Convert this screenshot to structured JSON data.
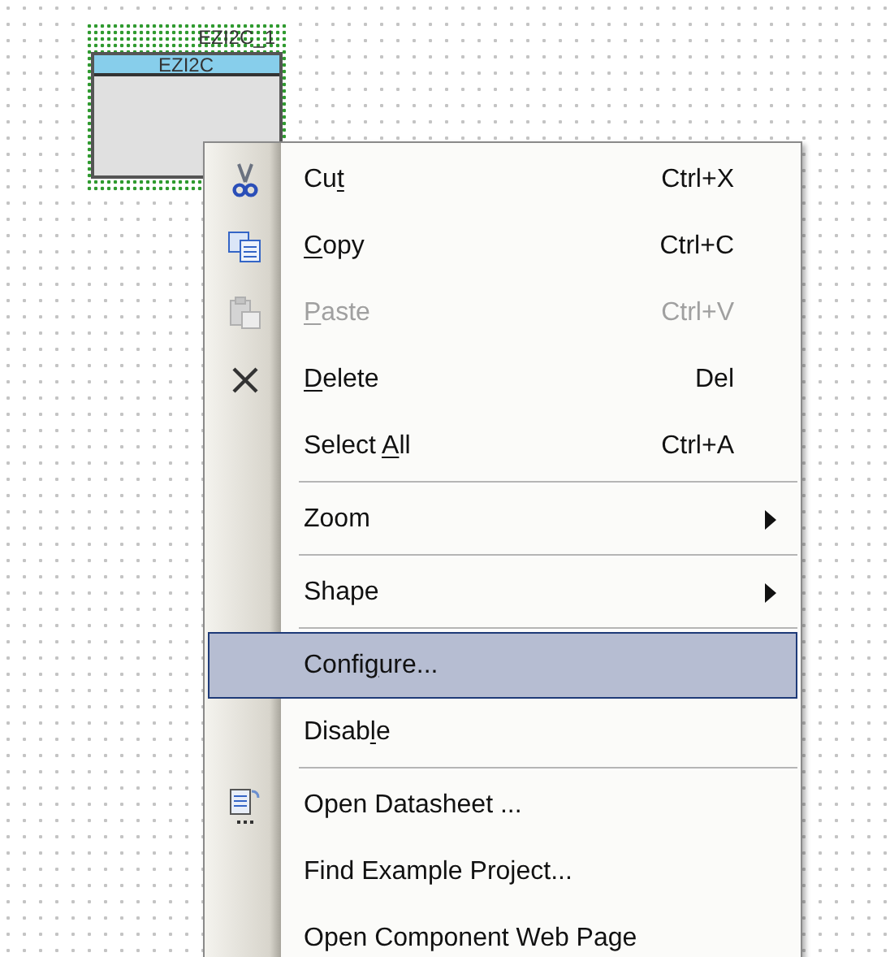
{
  "canvas": {
    "component": {
      "instance_name": "EZI2C_1",
      "title": "EZI2C"
    }
  },
  "context_menu": {
    "items": [
      {
        "kind": "item",
        "label_start": "Cu",
        "access_key": "t",
        "shortcut": "Ctrl+X",
        "disabled": false,
        "selected": false
      },
      {
        "kind": "item",
        "access_key": "C",
        "label_end": "opy",
        "shortcut": "Ctrl+C",
        "disabled": false,
        "selected": false
      },
      {
        "kind": "item",
        "access_key": "P",
        "label_end": "aste",
        "shortcut": "Ctrl+V",
        "disabled": true,
        "selected": false
      },
      {
        "kind": "item",
        "access_key": "D",
        "label_end": "elete",
        "shortcut": "Del",
        "disabled": false,
        "selected": false
      },
      {
        "kind": "item",
        "label_start": "Select ",
        "access_key": "A",
        "label_end": "ll",
        "shortcut": "Ctrl+A",
        "disabled": false,
        "selected": false
      },
      {
        "kind": "separator"
      },
      {
        "kind": "submenu",
        "label_start": "Zoom",
        "disabled": false,
        "selected": false
      },
      {
        "kind": "separator"
      },
      {
        "kind": "submenu",
        "label_start": "Shape",
        "disabled": false,
        "selected": false
      },
      {
        "kind": "separator"
      },
      {
        "kind": "item",
        "label_start": "Confi",
        "access_key": "g",
        "label_end": "ure...",
        "disabled": false,
        "selected": true
      },
      {
        "kind": "item",
        "label_start": "Disab",
        "access_key": "l",
        "label_end": "e",
        "disabled": false,
        "selected": false
      },
      {
        "kind": "separator"
      },
      {
        "kind": "item",
        "label_start": "Open Datasheet ...",
        "disabled": false,
        "selected": false
      },
      {
        "kind": "item",
        "label_start": "Find Example Project...",
        "disabled": false,
        "selected": false
      },
      {
        "kind": "item",
        "label_start": "Open Component Web Page",
        "disabled": false,
        "selected": false
      }
    ]
  }
}
